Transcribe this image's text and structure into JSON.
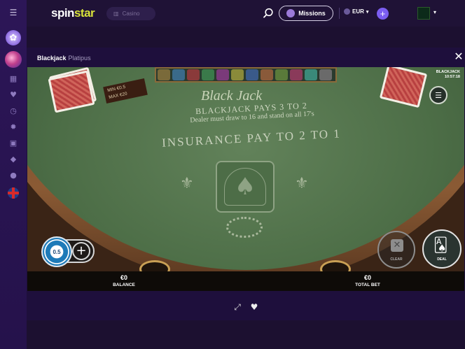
{
  "header": {
    "logo_part1": "spin",
    "logo_part2": "star",
    "casino_label": "Casino",
    "missions_label": "Missions",
    "currency": "EUR",
    "currency_caret": "▾",
    "add_funds_symbol": "+",
    "avatar_caret": "▾"
  },
  "sidebar": {
    "icons": [
      "menu-icon",
      "flower-icon",
      "planet-icon",
      "grid-icon",
      "heart-icon",
      "clock-icon",
      "gear-icon",
      "gift-icon",
      "diamond-icon",
      "chat-icon",
      "uk-flag-icon"
    ]
  },
  "game": {
    "title": "Blackjack",
    "provider": "Platipus",
    "close_symbol": "✕",
    "table": {
      "script_title": "Black Jack",
      "pays_line": "BLACKJACK PAYS 3 TO 2",
      "dealer_line": "Dealer must draw to 16 and stand on all 17's",
      "insurance_line": "INSURANCE PAY TO 2 TO 1",
      "min_bet": "MIN €0.5",
      "max_bet": "MAX €20",
      "corner_title": "BLACKJACK",
      "corner_time": "10:57:18"
    },
    "chip_value": "0.5",
    "chip_plus_symbol": "+",
    "clear_label": "CLEAR",
    "deal_label": "DEAL",
    "balance_value": "€0",
    "balance_label": "BALANCE",
    "total_bet_value": "€0",
    "total_bet_label": "TOTAL BET"
  },
  "colors": {
    "accent": "#7b5df0",
    "logo_star": "#d8e23a",
    "felt": "#4d6e47"
  }
}
